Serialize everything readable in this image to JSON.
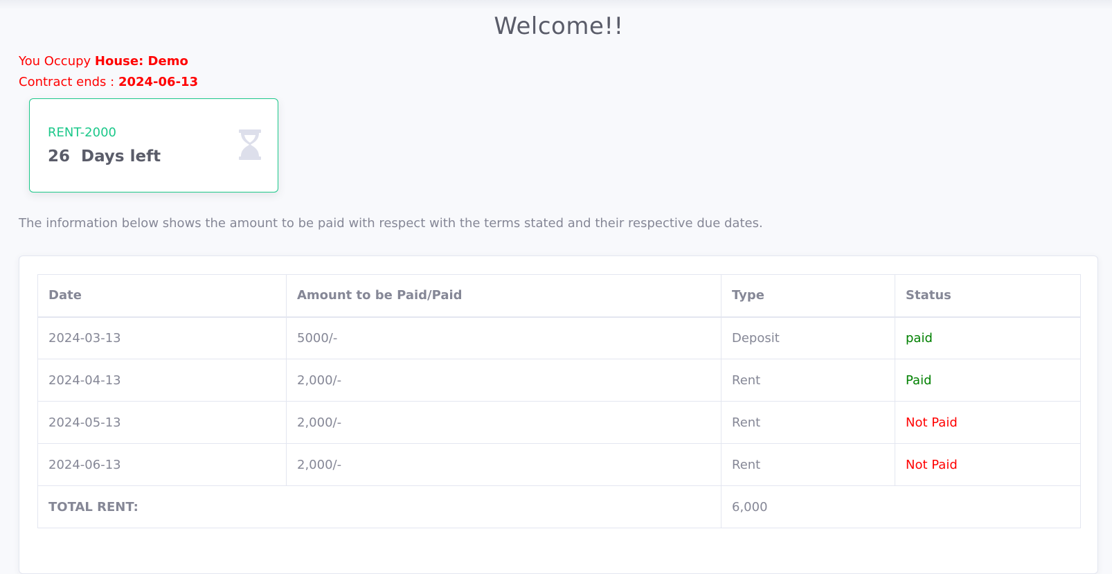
{
  "header": {
    "title": "Welcome!!"
  },
  "occupancy": {
    "prefix": "You Occupy ",
    "house": "House: Demo",
    "contract_prefix": "Contract ends : ",
    "contract_end": "2024-06-13"
  },
  "card": {
    "title": "RENT-2000",
    "days": "26",
    "days_label": "Days left",
    "icon": "hourglass-icon",
    "accent": "#1cc88a"
  },
  "info_text": "The information below shows the amount to be paid with respect with the terms stated and their respective due dates.",
  "table": {
    "headers": [
      "Date",
      "Amount to be Paid/Paid",
      "Type",
      "Status"
    ],
    "rows": [
      {
        "date": "2024-03-13",
        "amount": "5000/-",
        "type": "Deposit",
        "status": "paid"
      },
      {
        "date": "2024-04-13",
        "amount": "2,000/-",
        "type": "Rent",
        "status": "Paid"
      },
      {
        "date": "2024-05-13",
        "amount": "2,000/-",
        "type": "Rent",
        "status": "Not Paid"
      },
      {
        "date": "2024-06-13",
        "amount": "2,000/-",
        "type": "Rent",
        "status": "Not Paid"
      }
    ],
    "total_label": "TOTAL RENT:",
    "total_value": "6,000"
  },
  "colors": {
    "paid": "#008000",
    "not_paid": "#ff0000",
    "occupancy": "#ff0000"
  }
}
